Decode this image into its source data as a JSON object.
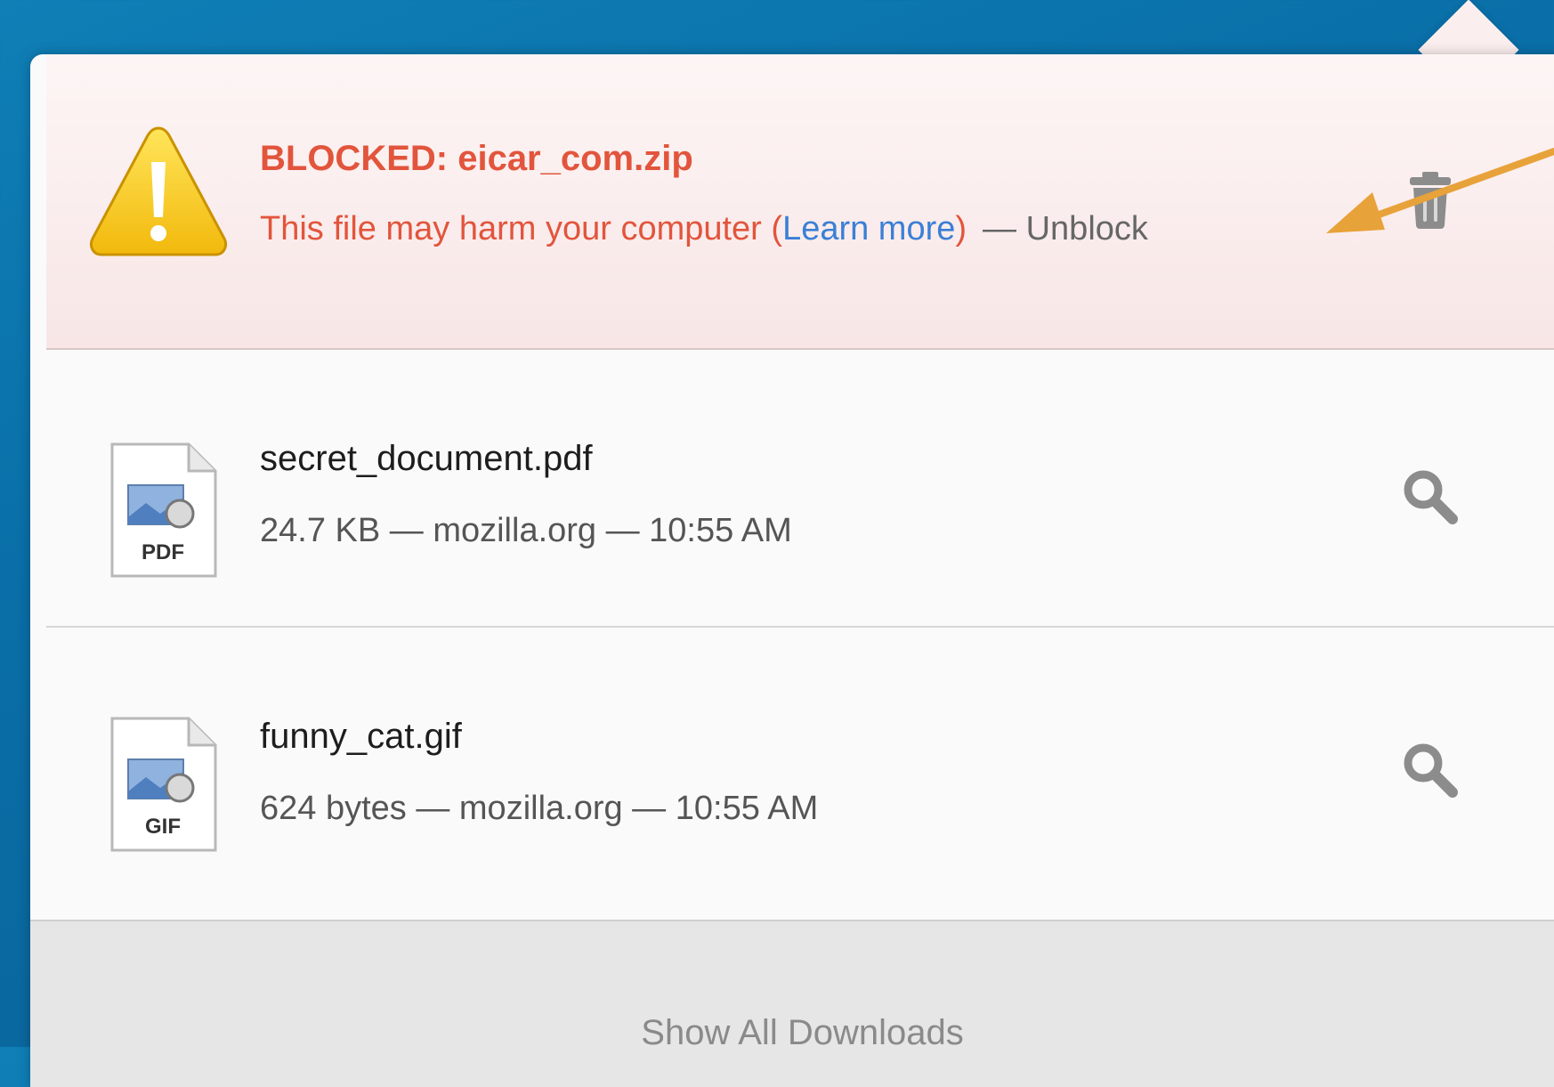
{
  "colors": {
    "blocked_text": "#e2553c",
    "link": "#3a7fd6",
    "annotation_arrow": "#e8a23a"
  },
  "downloads": [
    {
      "status": "blocked",
      "icon": "warning-icon",
      "name": "BLOCKED: eicar_com.zip",
      "message": "This file may harm your computer (",
      "learn_more": "Learn more",
      "message_close": ")",
      "unblock": "— Unblock",
      "action_icon": "trash-icon"
    },
    {
      "status": "complete",
      "icon": "pdf-file-icon",
      "icon_label": "PDF",
      "name": "secret_document.pdf",
      "detail": "24.7 KB — mozilla.org — 10:55 AM",
      "action_icon": "magnifier-icon"
    },
    {
      "status": "complete",
      "icon": "gif-file-icon",
      "icon_label": "GIF",
      "name": "funny_cat.gif",
      "detail": "624 bytes — mozilla.org — 10:55 AM",
      "action_icon": "magnifier-icon"
    }
  ],
  "footer": {
    "label": "Show All Downloads"
  }
}
